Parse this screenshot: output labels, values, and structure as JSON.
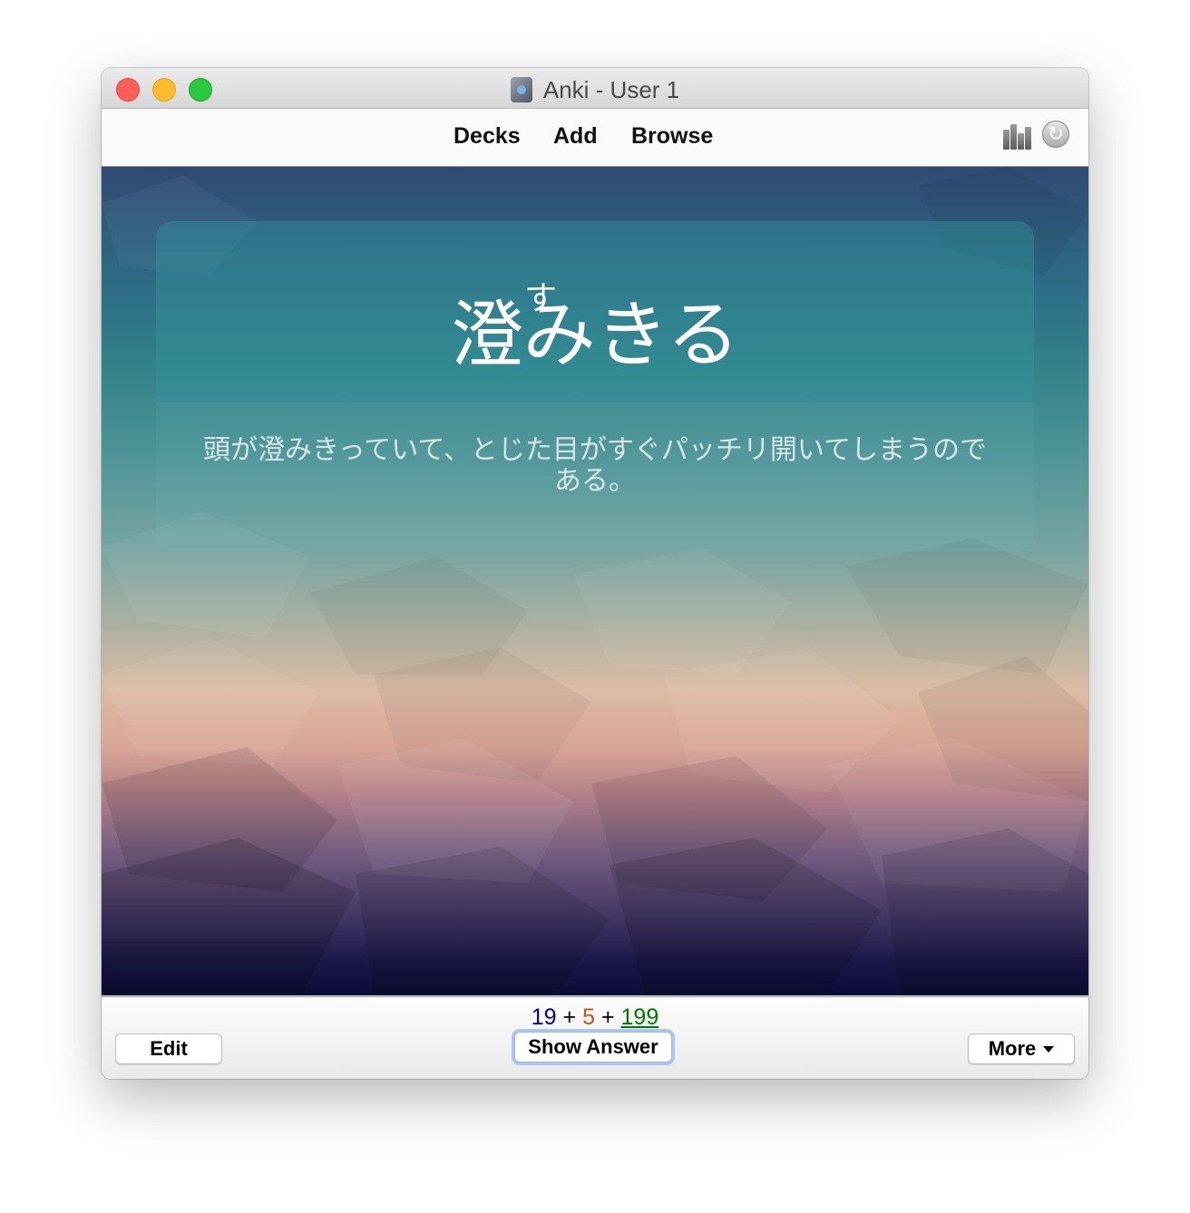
{
  "window": {
    "title": "Anki - User 1"
  },
  "toolbar": {
    "decks_label": "Decks",
    "add_label": "Add",
    "browse_label": "Browse",
    "right_icons": [
      "stats-icon",
      "sync-icon"
    ]
  },
  "card": {
    "ruby": "す",
    "term": "澄みきる",
    "sentence": "頭が澄みきっていて、とじた目がすぐパッチリ開いてしまうのである。"
  },
  "bottombar": {
    "counts": {
      "new": "19",
      "learning": "5",
      "review": "199",
      "separator": "+"
    },
    "edit_label": "Edit",
    "show_answer_label": "Show Answer",
    "more_label": "More"
  },
  "colors": {
    "new": "#000080",
    "learning": "#c35617",
    "review": "#007700",
    "close": "#fc5f57",
    "minimize": "#fdbc2e",
    "maximize": "#29c840"
  }
}
